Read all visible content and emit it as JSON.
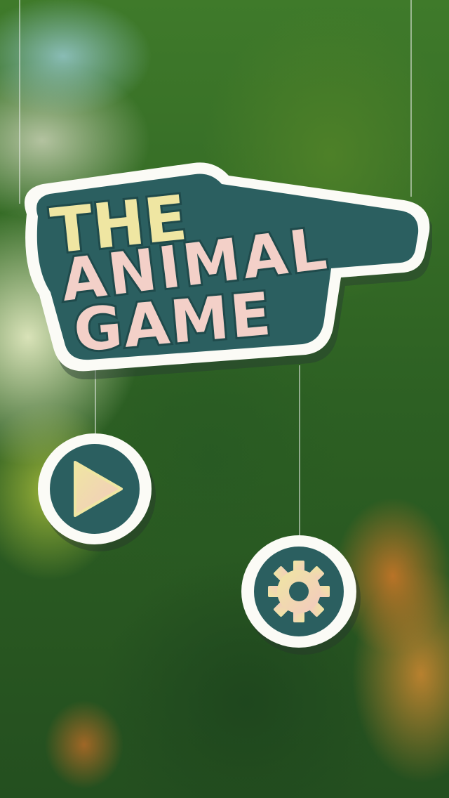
{
  "title": {
    "line1": "THE",
    "line2": "ANIMAL",
    "line3": "GAME"
  },
  "buttons": {
    "play_icon": "play-icon",
    "settings_icon": "gear-icon"
  },
  "colors": {
    "panel_border": "#fbfbf6",
    "panel_fill": "#2b5f60",
    "title_yellow": "#efe6a2",
    "title_pink": "#f3d0c8"
  }
}
